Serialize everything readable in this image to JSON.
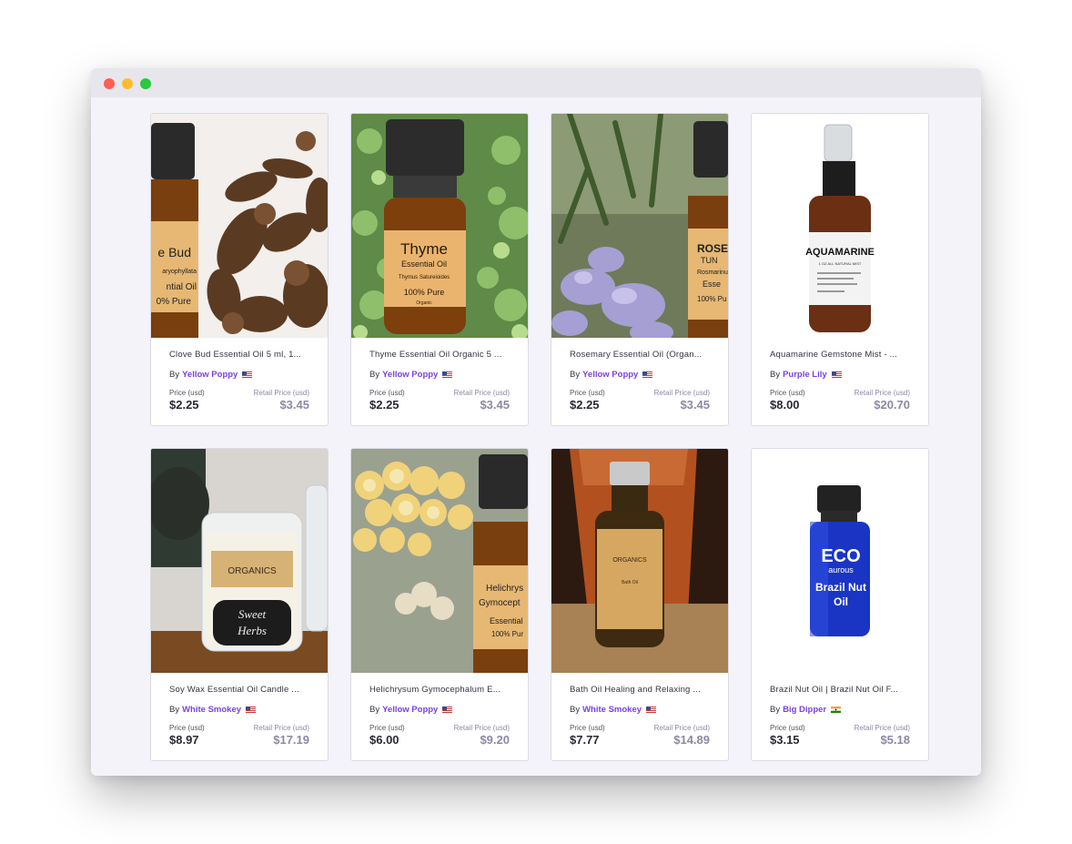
{
  "window": {
    "controls": [
      "close",
      "minimize",
      "zoom"
    ]
  },
  "price_label": "Price (usd)",
  "retail_label": "Retail Price (usd)",
  "by_label": "By",
  "products": [
    {
      "name": "Clove Bud Essential Oil 5 ml, 1...",
      "seller": "Yellow Poppy",
      "flag": "us-flag-icon",
      "price": "$2.25",
      "retail": "$3.45",
      "image": {
        "label1": "e Bud",
        "label2": "aryophyllata",
        "label3": "ntial Oil",
        "label4": "0% Pure"
      }
    },
    {
      "name": "Thyme Essential Oil Organic 5 ...",
      "seller": "Yellow Poppy",
      "flag": "us-flag-icon",
      "price": "$2.25",
      "retail": "$3.45",
      "image": {
        "label1": "Thyme",
        "label2": "Essential Oil",
        "label3": "Thymus Satureioides",
        "label4": "100% Pure",
        "label5": "Organic"
      }
    },
    {
      "name": "Rosemary Essential Oil (Organ...",
      "seller": "Yellow Poppy",
      "flag": "us-flag-icon",
      "price": "$2.25",
      "retail": "$3.45",
      "image": {
        "label1": "ROSE",
        "label2": "TUN",
        "label3": "Rosmarinu",
        "label4": "Esse",
        "label5": "100% Pu"
      }
    },
    {
      "name": "Aquamarine Gemstone Mist - ...",
      "seller": "Purple Lily",
      "flag": "us-flag-icon",
      "price": "$8.00",
      "retail": "$20.70",
      "image": {
        "label1": "AQUAMARINE",
        "label2": "1 OZ ALL NATURAL MIST"
      }
    },
    {
      "name": "Soy Wax Essential Oil Candle ...",
      "seller": "White Smokey",
      "flag": "us-flag-icon",
      "price": "$8.97",
      "retail": "$17.19",
      "image": {
        "label1": "ORGANICS",
        "label2": "Sweet",
        "label3": "Herbs"
      }
    },
    {
      "name": "Helichrysum Gymocephalum E...",
      "seller": "Yellow Poppy",
      "flag": "us-flag-icon",
      "price": "$6.00",
      "retail": "$9.20",
      "image": {
        "label1": "Helichrys",
        "label2": "Gymocept",
        "label3": "Essential",
        "label4": "100% Pur"
      }
    },
    {
      "name": "Bath Oil Healing and Relaxing ...",
      "seller": "White Smokey",
      "flag": "us-flag-icon",
      "price": "$7.77",
      "retail": "$14.89",
      "image": {
        "label1": "ORGANICS",
        "label2": "Bath Oil"
      }
    },
    {
      "name": "Brazil Nut Oil | Brazil Nut Oil F...",
      "seller": "Big Dipper",
      "flag": "india-flag-icon",
      "price": "$3.15",
      "retail": "$5.18",
      "image": {
        "label1": "ECO",
        "label2": "aurous",
        "label3": "Brazil Nut",
        "label4": "Oil"
      }
    }
  ],
  "colors": {
    "seller": "#7b3fe4",
    "retail": "#8b8aa6",
    "background": "#f4f3f9"
  }
}
